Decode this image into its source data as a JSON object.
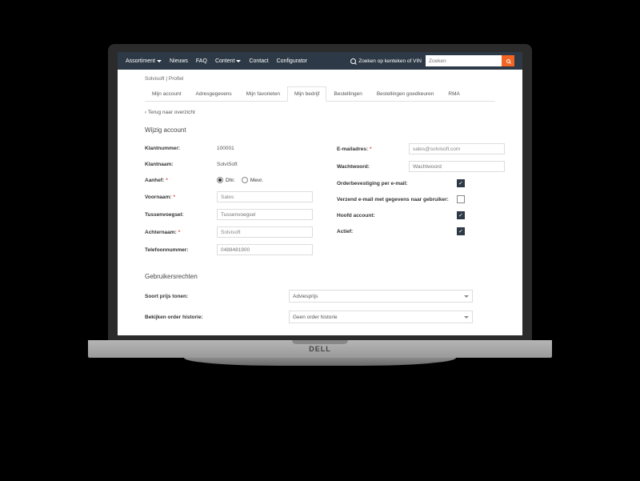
{
  "nav": {
    "items": [
      "Assortiment",
      "Nieuws",
      "FAQ",
      "Content",
      "Contact",
      "Configurator"
    ],
    "dropdown_idx": [
      0,
      3
    ]
  },
  "search": {
    "label": "Zoeken op kenteken of VIN",
    "placeholder": "Zoeken"
  },
  "breadcrumb": [
    "Solvisoft",
    "Profiel"
  ],
  "tabs": [
    "Mijn account",
    "Adresgegevens",
    "Mijn favorieten",
    "Mijn bedrijf",
    "Bestellingen",
    "Bestellingen goedkeuren",
    "RMA"
  ],
  "active_tab": 3,
  "back_link": "‹  Terug naar overzicht",
  "section_edit": "Wijzig account",
  "left_rows": [
    {
      "label": "Klantnummer:",
      "type": "text",
      "value": "100001"
    },
    {
      "label": "Klantnaam:",
      "type": "text",
      "value": "SolviSoft"
    },
    {
      "label": "Aanhef:",
      "required": true,
      "type": "radio",
      "options": [
        "Dhr.",
        "Mevr."
      ],
      "selected": 0
    },
    {
      "label": "Voornaam:",
      "required": true,
      "type": "input",
      "value": "Sales"
    },
    {
      "label": "Tussenvoegsel:",
      "type": "input",
      "placeholder": "Tussenvoegsel"
    },
    {
      "label": "Achternaam:",
      "required": true,
      "type": "input",
      "value": "Solvisoft"
    },
    {
      "label": "Telefoonnummer:",
      "type": "input",
      "placeholder": "0488481900"
    }
  ],
  "right_rows": [
    {
      "label": "E-mailadres:",
      "required": true,
      "type": "input",
      "value": "sales@solvisoft.com"
    },
    {
      "label": "Wachtwoord:",
      "type": "input",
      "placeholder": "Wachtwoord"
    },
    {
      "label": "Orderbevestiging per e-mail:",
      "type": "check",
      "checked": true
    },
    {
      "label": "Verzend e-mail met gegevens naar gebruiker:",
      "type": "check",
      "checked": false
    },
    {
      "label": "Hoofd account:",
      "type": "check",
      "checked": true
    },
    {
      "label": "Actief:",
      "type": "check",
      "checked": true
    }
  ],
  "section_rights": "Gebruikersrechten",
  "rights": [
    {
      "label": "Soort prijs tonen:",
      "value": "Adviesprijs"
    },
    {
      "label": "Bekijken order historie:",
      "value": "Geen order historie"
    }
  ],
  "device_logo": "DELL"
}
